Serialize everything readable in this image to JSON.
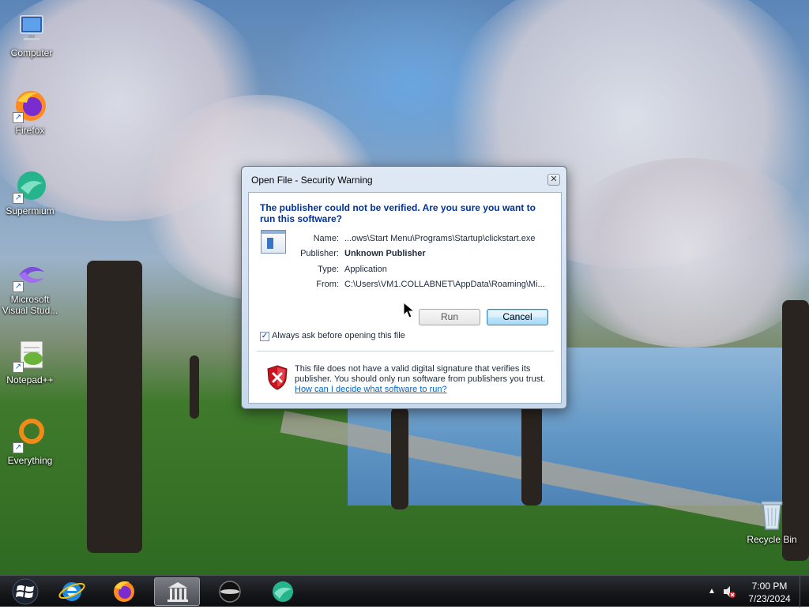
{
  "desktop": {
    "icons": [
      {
        "label": "Computer"
      },
      {
        "label": "Firefox"
      },
      {
        "label": "Supermium"
      },
      {
        "label": "Microsoft Visual Stud..."
      },
      {
        "label": "Notepad++"
      },
      {
        "label": "Everything"
      }
    ],
    "recycle_bin": {
      "label": "Recycle Bin"
    }
  },
  "dialog": {
    "title": "Open File - Security Warning",
    "close_glyph": "✕",
    "headline": "The publisher could not be verified.  Are you sure you want to run this software?",
    "fields": [
      {
        "label": "Name:",
        "value": "...ows\\Start Menu\\Programs\\Startup\\clickstart.exe"
      },
      {
        "label": "Publisher:",
        "value": "Unknown Publisher"
      },
      {
        "label": "Type:",
        "value": "Application"
      },
      {
        "label": "From:",
        "value": "C:\\Users\\VM1.COLLABNET\\AppData\\Roaming\\Mi..."
      }
    ],
    "run_label": "Run",
    "cancel_label": "Cancel",
    "checkbox_label": "Always ask before opening this file",
    "checkbox_checked": true,
    "checkbox_glyph": "✓",
    "warning_text": "This file does not have a valid digital signature that verifies its publisher.  You should only run software from publishers you trust.",
    "help_link": "How can I decide what software to run?"
  },
  "taskbar": {
    "items": [
      {
        "icon": "internet-explorer-icon"
      },
      {
        "icon": "firefox-icon"
      },
      {
        "icon": "library-icon",
        "active": true
      },
      {
        "icon": "sphere-icon"
      },
      {
        "icon": "supermium-icon"
      }
    ],
    "tray_arrow": "▲",
    "time": "7:00 PM",
    "date": "7/23/2024"
  },
  "colors": {
    "headline": "#003399",
    "link": "#0066cc",
    "shield_red": "#c8141e"
  }
}
